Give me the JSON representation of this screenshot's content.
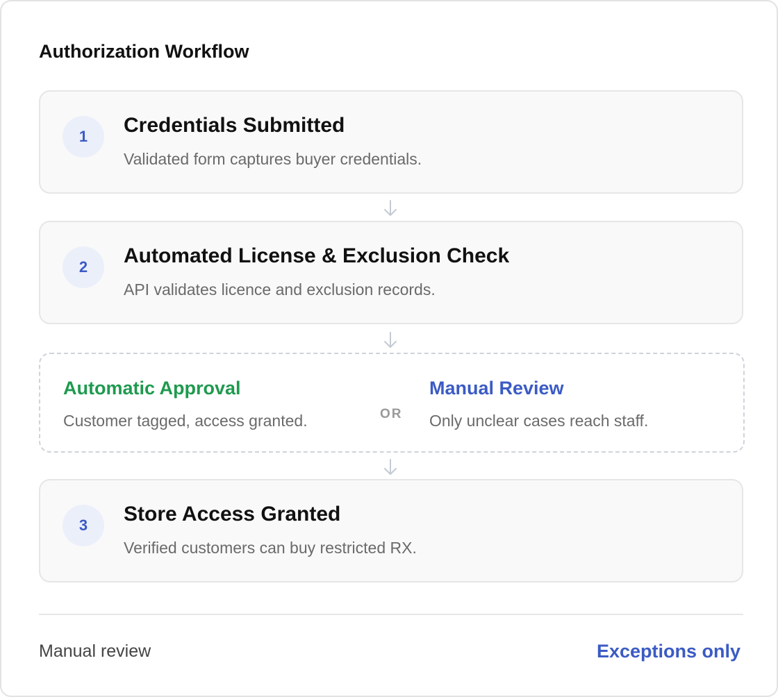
{
  "workflow": {
    "title": "Authorization Workflow",
    "steps": [
      {
        "number": "1",
        "title": "Credentials Submitted",
        "description": "Validated form captures buyer credentials."
      },
      {
        "number": "2",
        "title": "Automated License & Exclusion Check",
        "description": "API validates licence and exclusion records."
      },
      {
        "number": "3",
        "title": "Store Access Granted",
        "description": "Verified customers can buy restricted RX."
      }
    ],
    "branch": {
      "left": {
        "title": "Automatic Approval",
        "description": "Customer tagged, access granted."
      },
      "separator": "OR",
      "right": {
        "title": "Manual Review",
        "description": "Only unclear cases reach staff."
      }
    },
    "footer": {
      "label": "Manual review",
      "value": "Exceptions only"
    }
  },
  "colors": {
    "approval_green": "#1f9a4f",
    "accent_blue": "#3b5bc4",
    "step_badge_bg": "#ebeffa",
    "arrow_gray": "#c4cad3"
  },
  "icons": {
    "connector": "arrow-down-icon"
  }
}
